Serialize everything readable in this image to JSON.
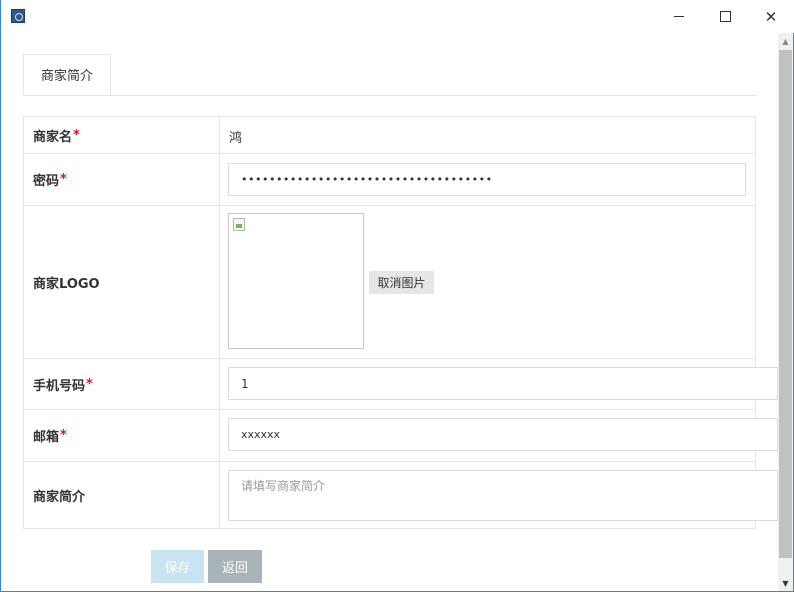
{
  "window": {
    "controls": {
      "minimize": "—",
      "maximize": "☐",
      "close": "✕"
    }
  },
  "tabs": [
    {
      "label": "商家简介"
    }
  ],
  "form": {
    "rows": [
      {
        "label": "商家名",
        "required": "*",
        "value": "鸿"
      },
      {
        "label": "密码",
        "required": "*",
        "value": "••••••••••••••••••••••••••••••••••••"
      },
      {
        "label": "商家LOGO",
        "required": "",
        "cancel_button": "取消图片"
      },
      {
        "label": "手机号码",
        "required": "*",
        "value": "1"
      },
      {
        "label": "邮箱",
        "required": "*",
        "value": "xxxxxx"
      },
      {
        "label": "商家简介",
        "required": "",
        "placeholder": "请填写商家简介"
      }
    ]
  },
  "actions": {
    "save": "保存",
    "back": "返回"
  },
  "colors": {
    "required": "#e0161b",
    "save_button": "#c9e3f0",
    "back_button": "#a8b4b7",
    "window_border": "#3b86d8"
  },
  "icons": {
    "app": "app-icon",
    "broken_image": "broken-image-icon",
    "scroll_up": "scroll-up-arrow-icon",
    "scroll_down": "scroll-down-arrow-icon"
  }
}
